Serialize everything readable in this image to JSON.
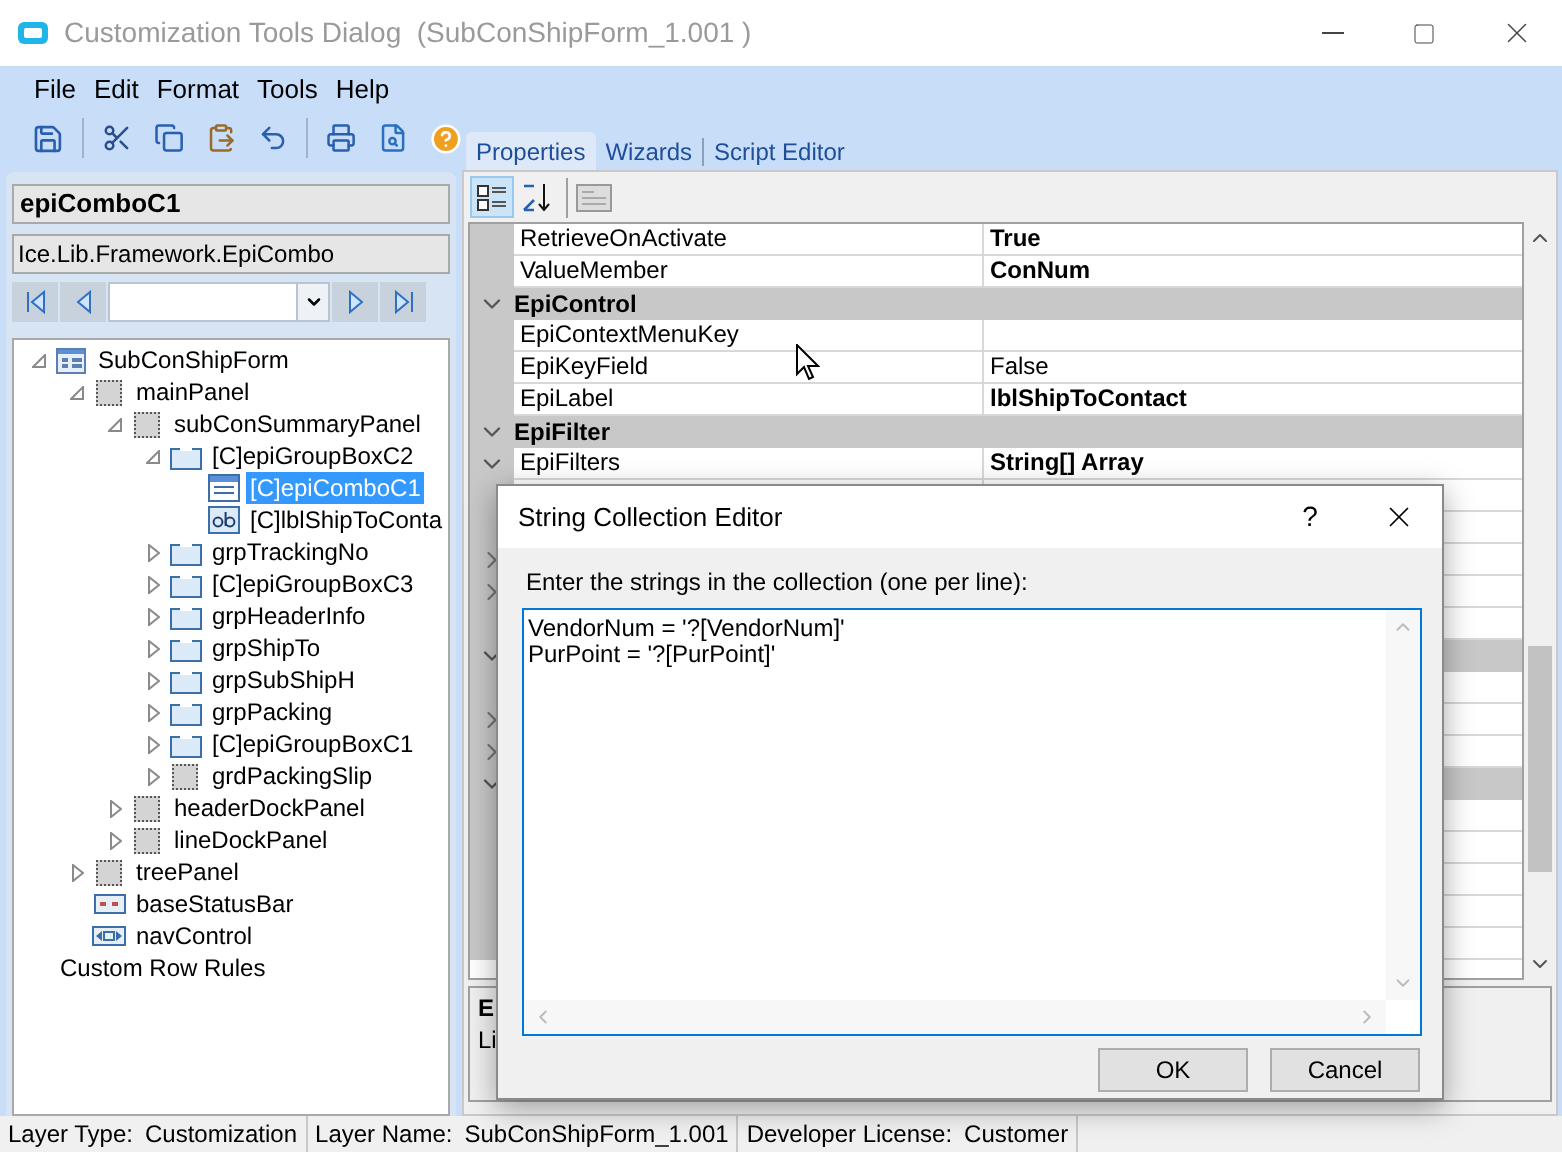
{
  "window": {
    "title": "Customization Tools Dialog  (SubConShipForm_1.001 )"
  },
  "menu": [
    "File",
    "Edit",
    "Format",
    "Tools",
    "Help"
  ],
  "selected_control": {
    "name": "epiComboC1",
    "type": "Ice.Lib.Framework.EpiCombo"
  },
  "tree": [
    {
      "label": "SubConShipForm",
      "kind": "form",
      "expanded": true,
      "selected": false,
      "children": [
        {
          "label": "mainPanel",
          "kind": "panel",
          "expanded": true,
          "selected": false,
          "children": [
            {
              "label": "subConSummaryPanel",
              "kind": "panel",
              "expanded": true,
              "selected": false,
              "children": [
                {
                  "label": "[C]epiGroupBoxC2",
                  "kind": "groupbox",
                  "expanded": true,
                  "selected": false,
                  "children": [
                    {
                      "label": "[C]epiComboC1",
                      "kind": "combo",
                      "selected": true
                    },
                    {
                      "label": "[C]lblShipToConta",
                      "kind": "label",
                      "selected": false
                    }
                  ]
                },
                {
                  "label": "grpTrackingNo",
                  "kind": "groupbox",
                  "expanded": false,
                  "selected": false
                },
                {
                  "label": "[C]epiGroupBoxC3",
                  "kind": "groupbox",
                  "expanded": false,
                  "selected": false
                },
                {
                  "label": "grpHeaderInfo",
                  "kind": "groupbox",
                  "expanded": false,
                  "selected": false
                },
                {
                  "label": "grpShipTo",
                  "kind": "groupbox",
                  "expanded": false,
                  "selected": false
                },
                {
                  "label": "grpSubShipH",
                  "kind": "groupbox",
                  "expanded": false,
                  "selected": false
                },
                {
                  "label": "grpPacking",
                  "kind": "groupbox",
                  "expanded": false,
                  "selected": false
                },
                {
                  "label": "[C]epiGroupBoxC1",
                  "kind": "groupbox",
                  "expanded": false,
                  "selected": false
                },
                {
                  "label": "grdPackingSlip",
                  "kind": "panel",
                  "expanded": false,
                  "selected": false
                }
              ]
            },
            {
              "label": "headerDockPanel",
              "kind": "panel",
              "expanded": false,
              "selected": false
            },
            {
              "label": "lineDockPanel",
              "kind": "panel",
              "expanded": false,
              "selected": false
            }
          ]
        },
        {
          "label": "treePanel",
          "kind": "panel",
          "expanded": false,
          "selected": false
        },
        {
          "label": "baseStatusBar",
          "kind": "statusbar",
          "selected": false
        },
        {
          "label": "navControl",
          "kind": "nav",
          "selected": false
        }
      ]
    },
    {
      "label": "Custom Row Rules",
      "kind": "text",
      "selected": false
    }
  ],
  "tabs": [
    {
      "label": "Properties",
      "selected": true
    },
    {
      "label": "Wizards",
      "selected": false
    },
    {
      "label": "Script Editor",
      "selected": false
    }
  ],
  "view_modes": [
    {
      "kind": "categorized",
      "selected": true
    },
    {
      "kind": "alphabetical",
      "selected": false
    }
  ],
  "properties": [
    {
      "kind": "property",
      "name": "RetrieveOnActivate",
      "value": "True",
      "modified": true
    },
    {
      "kind": "property",
      "name": "ValueMember",
      "value": "ConNum",
      "modified": true
    },
    {
      "kind": "category",
      "name": "EpiControl",
      "expanded": true
    },
    {
      "kind": "property",
      "name": "EpiContextMenuKey"
    },
    {
      "kind": "property",
      "name": "EpiKeyField",
      "value": "False",
      "modified": false
    },
    {
      "kind": "property",
      "name": "EpiLabel",
      "value": "lblShipToContact",
      "modified": true
    },
    {
      "kind": "category",
      "name": "EpiFilter",
      "expanded": true
    },
    {
      "kind": "property",
      "name": "EpiFilters",
      "value": "String[] Array",
      "modified": true,
      "expanded": true
    },
    {
      "kind": "property"
    },
    {
      "kind": "property"
    },
    {
      "kind": "property",
      "expanded": false
    },
    {
      "kind": "property",
      "expanded": false
    },
    {
      "kind": "property"
    },
    {
      "kind": "category",
      "expanded": true
    },
    {
      "kind": "property"
    },
    {
      "kind": "property",
      "expanded": false
    },
    {
      "kind": "property",
      "expanded": false
    },
    {
      "kind": "category",
      "expanded": true
    },
    {
      "kind": "property"
    },
    {
      "kind": "property"
    },
    {
      "kind": "property"
    },
    {
      "kind": "property"
    },
    {
      "kind": "property"
    }
  ],
  "description": {
    "title": "E",
    "text": "Li"
  },
  "dialog": {
    "title": "String Collection Editor",
    "help": "?",
    "prompt": "Enter the strings in the collection (one per line):",
    "value": "VendorNum = '?[VendorNum]'\nPurPoint = '?[PurPoint]'",
    "buttons": [
      "OK",
      "Cancel"
    ]
  },
  "status_bar": [
    {
      "label": "Layer Type:",
      "value": "Customization"
    },
    {
      "label": "Layer Name:",
      "value": "SubConShipForm_1.001"
    },
    {
      "label": "Developer License:",
      "value": "Customer"
    }
  ]
}
